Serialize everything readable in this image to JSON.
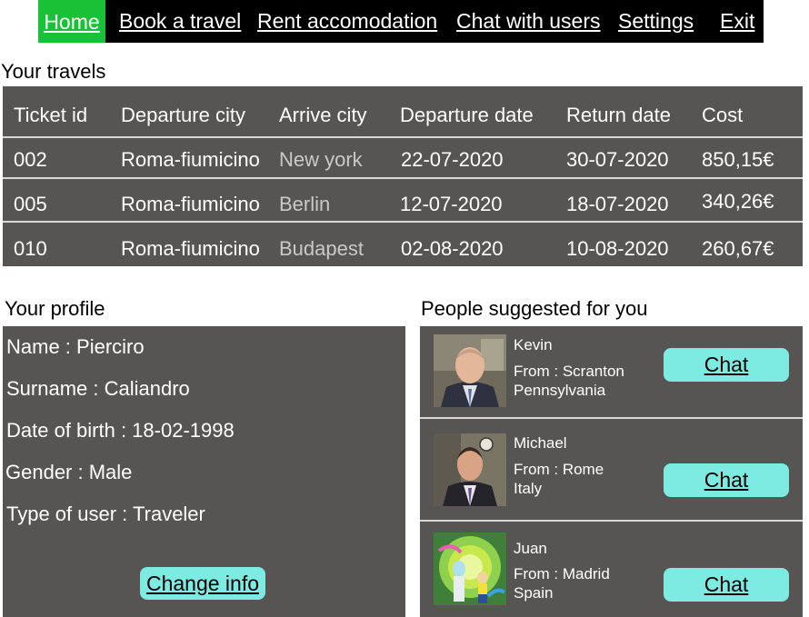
{
  "nav": {
    "home": "Home",
    "book": "Book a travel",
    "rent": "Rent accomodation",
    "chat": "Chat with users",
    "settings": "Settings",
    "exit": "Exit"
  },
  "travels": {
    "title": "Your travels",
    "headers": [
      "Ticket id",
      "Departure city",
      "Arrive city",
      "Departure date",
      "Return date",
      "Cost"
    ],
    "rows": [
      [
        "002",
        "Roma-fiumicino",
        "New york",
        "22-07-2020",
        "30-07-2020",
        "850,15€"
      ],
      [
        "005",
        "Roma-fiumicino",
        "Berlin",
        "12-07-2020",
        "18-07-2020",
        "340,26€"
      ],
      [
        "010",
        "Roma-fiumicino",
        "Budapest",
        "02-08-2020",
        "10-08-2020",
        "260,67€"
      ]
    ]
  },
  "profile": {
    "title": "Your profile",
    "name": "Name : Pierciro",
    "surname": "Surname : Caliandro",
    "dob": "Date of birth : 18-02-1998",
    "gender": "Gender : Male",
    "type": "Type of user : Traveler",
    "change_label": "Change info"
  },
  "people": {
    "title": "People suggested for you",
    "chat_label": "Chat",
    "list": [
      {
        "name": "Kevin",
        "from": "From : Scranton",
        "country": "Pennsylvania"
      },
      {
        "name": "Michael",
        "from": "From : Rome",
        "country": "Italy"
      },
      {
        "name": "Juan",
        "from": "From : Madrid",
        "country": "Spain"
      }
    ]
  }
}
